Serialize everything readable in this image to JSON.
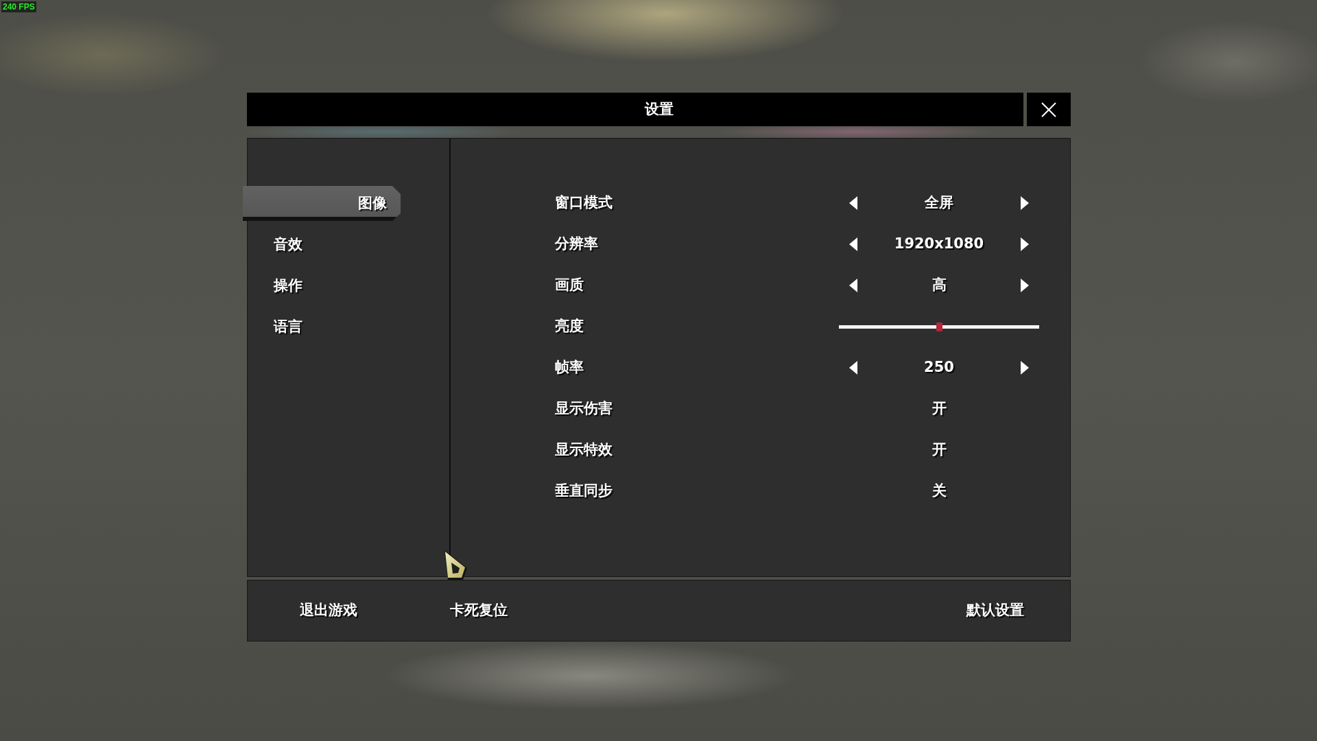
{
  "fps_counter": "240 FPS",
  "dialog": {
    "title": "设置"
  },
  "sidebar": {
    "items": [
      {
        "label": "图像",
        "selected": true
      },
      {
        "label": "音效",
        "selected": false
      },
      {
        "label": "操作",
        "selected": false
      },
      {
        "label": "语言",
        "selected": false
      }
    ]
  },
  "settings": [
    {
      "kind": "selector",
      "label": "窗口模式",
      "value": "全屏"
    },
    {
      "kind": "selector",
      "label": "分辨率",
      "value": "1920x1080"
    },
    {
      "kind": "selector",
      "label": "画质",
      "value": "高"
    },
    {
      "kind": "slider",
      "label": "亮度",
      "level": 0.5
    },
    {
      "kind": "selector",
      "label": "帧率",
      "value": "250"
    },
    {
      "kind": "toggle",
      "label": "显示伤害",
      "value": "开"
    },
    {
      "kind": "toggle",
      "label": "显示特效",
      "value": "开"
    },
    {
      "kind": "toggle",
      "label": "垂直同步",
      "value": "关"
    }
  ],
  "footer_buttons": [
    "退出游戏",
    "卡死复位",
    "默认设置"
  ]
}
